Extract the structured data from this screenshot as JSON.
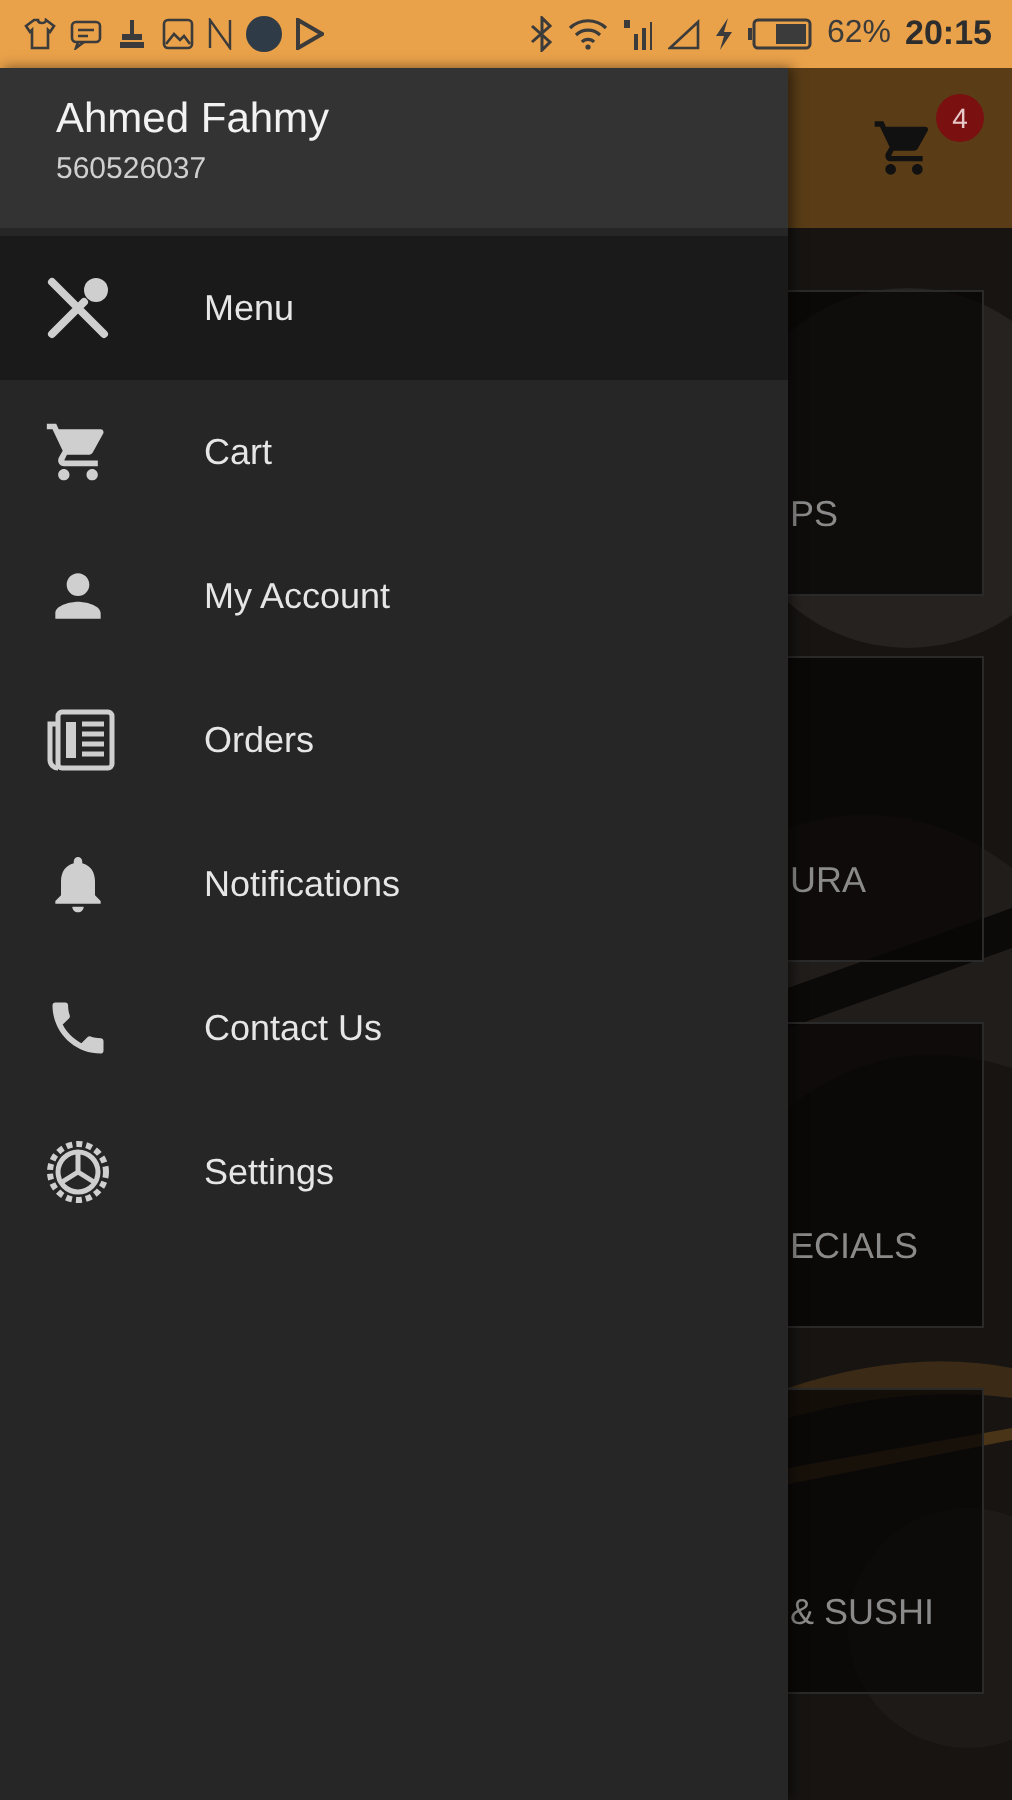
{
  "status_bar": {
    "battery": "62%",
    "time": "20:15"
  },
  "drawer": {
    "user_name": "Ahmed Fahmy",
    "phone": "560526037",
    "items": [
      {
        "label": "Menu",
        "selected": true
      },
      {
        "label": "Cart",
        "selected": false
      },
      {
        "label": "My Account",
        "selected": false
      },
      {
        "label": "Orders",
        "selected": false
      },
      {
        "label": "Notifications",
        "selected": false
      },
      {
        "label": "Contact Us",
        "selected": false
      },
      {
        "label": "Settings",
        "selected": false
      }
    ]
  },
  "app_bar": {
    "cart_badge": "4"
  },
  "categories": [
    {
      "label": "PS"
    },
    {
      "label": "URA"
    },
    {
      "label": "ECIALS"
    },
    {
      "label": "& SUSHI"
    }
  ]
}
